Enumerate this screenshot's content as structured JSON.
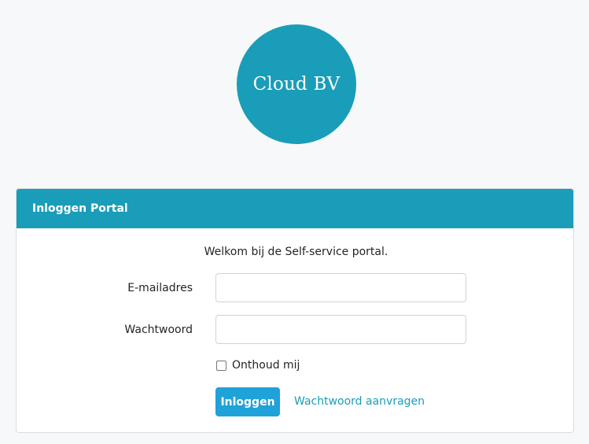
{
  "logo": {
    "text": "Cloud BV"
  },
  "card": {
    "title": "Inloggen Portal",
    "welcome": "Welkom bij de Self-service portal."
  },
  "form": {
    "email_label": "E-mailadres",
    "email_value": "",
    "password_label": "Wachtwoord",
    "password_value": "",
    "remember_label": "Onthoud mij",
    "remember_checked": false,
    "login_label": "Inloggen",
    "forgot_label": "Wachtwoord aanvragen"
  },
  "colors": {
    "brand": "#1a9db8",
    "button": "#1fa2d8",
    "background": "#f7f8fa"
  }
}
